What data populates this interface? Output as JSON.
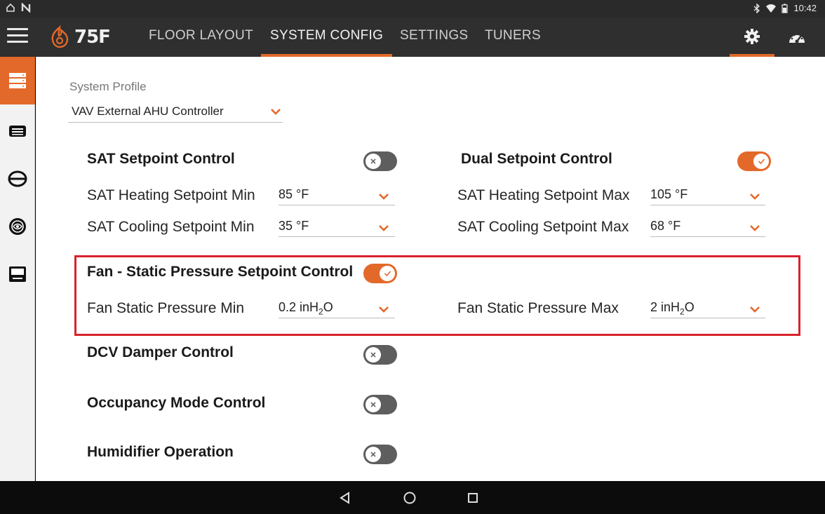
{
  "status_bar": {
    "left_icons": [
      "home-outline-icon",
      "notification-n-icon"
    ],
    "right_icons": [
      "bluetooth-icon",
      "wifi-icon",
      "battery-icon"
    ],
    "time": "10:42"
  },
  "app_bar": {
    "logo_text": "75F",
    "tabs": [
      {
        "label": "FLOOR LAYOUT",
        "active": false
      },
      {
        "label": "SYSTEM CONFIG",
        "active": true
      },
      {
        "label": "SETTINGS",
        "active": false
      },
      {
        "label": "TUNERS",
        "active": false
      }
    ],
    "right_icons": [
      {
        "name": "gear-icon",
        "active": true
      },
      {
        "name": "speedometer-icon",
        "active": false
      }
    ]
  },
  "sidebar": {
    "items": [
      {
        "icon": "server-stack-icon",
        "active": true
      },
      {
        "icon": "device-card-icon",
        "active": false
      },
      {
        "icon": "oval-divider-icon",
        "active": false
      },
      {
        "icon": "fan-disc-icon",
        "active": false
      },
      {
        "icon": "thermostat-box-icon",
        "active": false
      }
    ]
  },
  "system_profile": {
    "label": "System Profile",
    "value": "VAV External AHU Controller"
  },
  "sat_setpoint_control": {
    "title": "SAT Setpoint Control",
    "enabled": false,
    "heating_min_label": "SAT Heating Setpoint Min",
    "heating_min_value": "85 °F",
    "cooling_min_label": "SAT Cooling Setpoint Min",
    "cooling_min_value": "35 °F"
  },
  "dual_setpoint_control": {
    "title": "Dual Setpoint Control",
    "enabled": true,
    "heating_max_label": "SAT Heating Setpoint Max",
    "heating_max_value": "105 °F",
    "cooling_max_label": "SAT Cooling Setpoint Max",
    "cooling_max_value": "68 °F"
  },
  "fan_static_pressure": {
    "title": "Fan - Static Pressure Setpoint Control",
    "enabled": true,
    "min_label": "Fan Static Pressure Min",
    "min_value_prefix": "0.2 inH",
    "min_value_sub": "2",
    "min_value_suffix": "O",
    "max_label": "Fan Static Pressure Max",
    "max_value_prefix": "2 inH",
    "max_value_sub": "2",
    "max_value_suffix": "O"
  },
  "dcv_damper_control": {
    "title": "DCV Damper Control",
    "enabled": false
  },
  "occupancy_mode_control": {
    "title": "Occupancy Mode Control",
    "enabled": false
  },
  "humidifier_operation": {
    "title": "Humidifier Operation",
    "enabled": false
  },
  "colors": {
    "accent": "#e3692a",
    "highlight_box": "#d9222c",
    "app_bar": "#2f2f2f",
    "toggle_off": "#5e5e5e"
  },
  "nav_bar": {
    "buttons": [
      "back-icon",
      "home-icon",
      "recents-icon"
    ]
  }
}
